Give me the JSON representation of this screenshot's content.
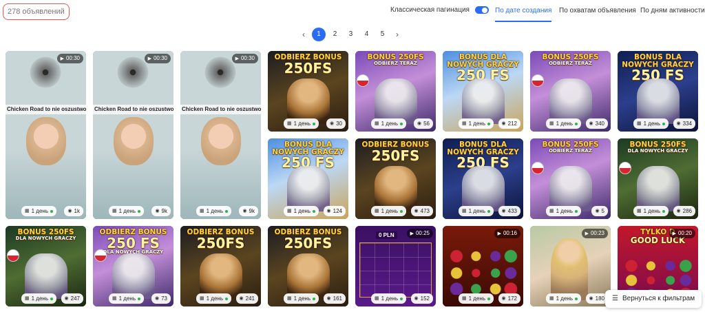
{
  "header": {
    "count_label": "278 объявлений",
    "pagination_toggle_label": "Классическая пагинация",
    "pagination_toggle_on": true,
    "sort_options": [
      {
        "label": "По дате создания",
        "active": true
      },
      {
        "label": "По охватам объявления",
        "active": false
      },
      {
        "label": "По дням активности",
        "active": false
      }
    ]
  },
  "pagination": {
    "prev_icon": "chevron-left-icon",
    "next_icon": "chevron-right-icon",
    "pages": [
      "1",
      "2",
      "3",
      "4",
      "5"
    ],
    "current": "1"
  },
  "cards": [
    {
      "duration": "00:30",
      "caption": "Chicken Road to nie oszustwo",
      "days": "1 день",
      "views": "1k",
      "art": "video"
    },
    {
      "duration": "00:30",
      "caption": "Chicken Road to nie oszustwo",
      "days": "1 день",
      "views": "9k",
      "art": "video"
    },
    {
      "duration": "00:30",
      "caption": "Chicken Road to nie oszustwo",
      "days": "1 день",
      "views": "9k",
      "art": "video"
    },
    {
      "promo1": "ODBIERZ BONUS",
      "promo2": "250FS",
      "days": "1 день",
      "views": "30",
      "art": "dark"
    },
    {
      "promo1": "BONUS 250FS",
      "promo3": "ODBIERZ TERAZ",
      "days": "1 день",
      "views": "56",
      "art": "purple"
    },
    {
      "promo1": "BONUS DLA NOWYCH GRACZY",
      "promo2": "250 FS",
      "days": "1 день",
      "views": "212",
      "art": "sky"
    },
    {
      "promo1": "BONUS 250FS",
      "promo3": "ODBIERZ TERAZ",
      "days": "1 день",
      "views": "340",
      "art": "purple"
    },
    {
      "promo1": "BONUS DLA NOWYCH GRACZY",
      "promo2": "250 FS",
      "days": "1 день",
      "views": "334",
      "art": "navy"
    },
    {
      "promo1": "BONUS DLA NOWYCH GRACZY",
      "promo2": "250 FS",
      "days": "1 день",
      "views": "124",
      "art": "sky"
    },
    {
      "promo1": "ODBIERZ BONUS",
      "promo2": "250FS",
      "days": "1 день",
      "views": "473",
      "art": "dark"
    },
    {
      "promo1": "BONUS DLA NOWYCH GRACZY",
      "promo2": "250 FS",
      "days": "1 день",
      "views": "433",
      "art": "navy"
    },
    {
      "promo1": "BONUS 250FS",
      "promo3": "ODBIERZ TERAZ",
      "days": "1 день",
      "views": "5",
      "art": "purple"
    },
    {
      "promo1": "BONUS 250FS",
      "promo3": "DLA NOWYCH GRACZY",
      "days": "1 день",
      "views": "286",
      "art": "green"
    },
    {
      "promo1": "BONUS 250FS",
      "promo3": "DLA NOWYCH GRACZY",
      "days": "1 день",
      "views": "247",
      "art": "green"
    },
    {
      "promo1": "ODBIERZ BONUS",
      "promo2": "250 FS",
      "promo3": "DLA NOWYCH GRACZY",
      "days": "1 день",
      "views": "73",
      "art": "purple"
    },
    {
      "promo1": "ODBIERZ BONUS",
      "promo2": "250FS",
      "days": "1 день",
      "views": "241",
      "art": "dark"
    },
    {
      "promo1": "ODBIERZ BONUS",
      "promo2": "250FS",
      "days": "1 день",
      "views": "161",
      "art": "dark"
    },
    {
      "duration": "00:25",
      "slot_label": "0 PLN",
      "days": "1 день",
      "views": "152",
      "art": "slot"
    },
    {
      "duration": "00:16",
      "days": "1 день",
      "views": "172",
      "art": "slot2"
    },
    {
      "duration": "00:23",
      "days": "1 день",
      "views": "180",
      "art": "photo"
    },
    {
      "duration": "00:20",
      "promo1": "TYLKO D",
      "promo3": "GOOD LUCK",
      "days": "1 день",
      "views": "",
      "art": "slot3"
    }
  ],
  "back_button": {
    "label": "Вернуться к фильтрам",
    "icon": "filter-icon"
  },
  "icons": {
    "play": "play-icon",
    "calendar": "calendar-icon",
    "eye": "eye-icon"
  },
  "colors": {
    "accent": "#2a6df4",
    "count_border": "#e05a4e",
    "active_dot": "#2db34a"
  }
}
